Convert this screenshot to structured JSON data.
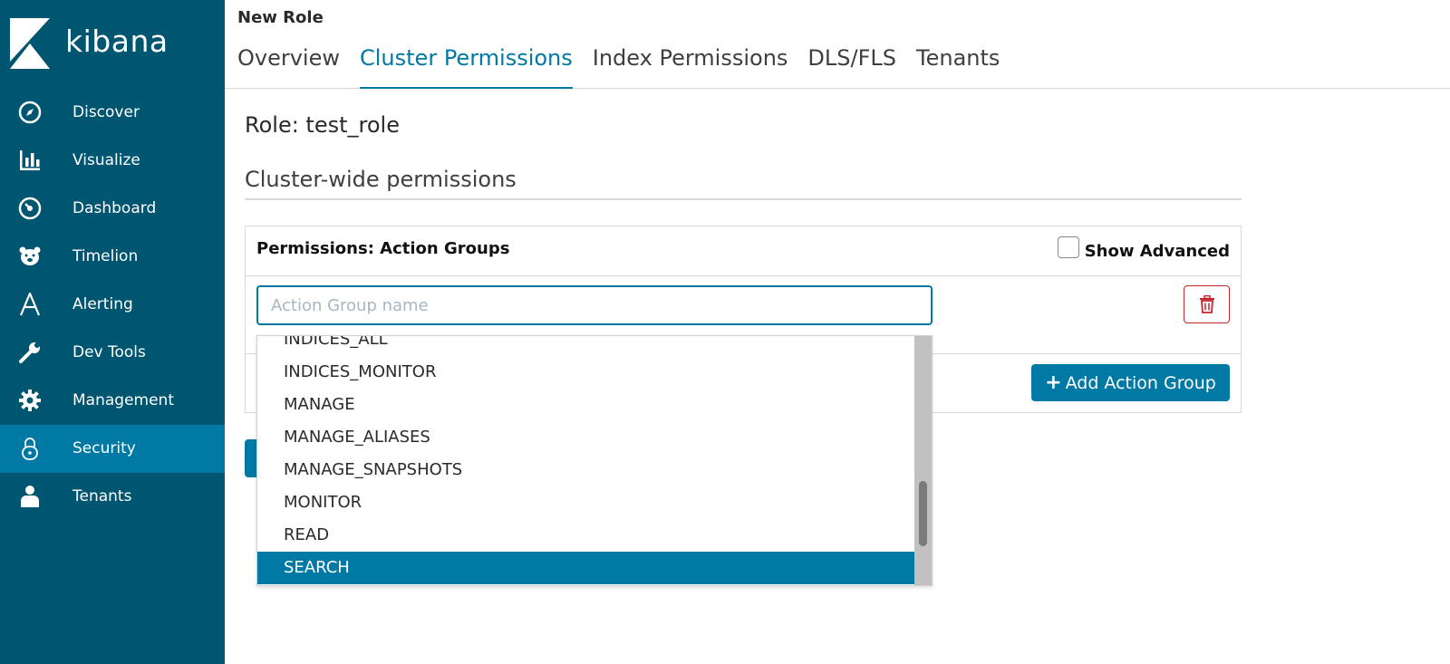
{
  "app": {
    "logo_text": "kibana"
  },
  "sidebar": {
    "items": [
      {
        "label": "Discover",
        "icon": "compass-icon",
        "active": false
      },
      {
        "label": "Visualize",
        "icon": "bar-chart-icon",
        "active": false
      },
      {
        "label": "Dashboard",
        "icon": "dashboard-gauge-icon",
        "active": false
      },
      {
        "label": "Timelion",
        "icon": "timelion-bear-icon",
        "active": false
      },
      {
        "label": "Alerting",
        "icon": "alerting-icon",
        "active": false
      },
      {
        "label": "Dev Tools",
        "icon": "wrench-icon",
        "active": false
      },
      {
        "label": "Management",
        "icon": "gear-icon",
        "active": false
      },
      {
        "label": "Security",
        "icon": "lock-icon",
        "active": true
      },
      {
        "label": "Tenants",
        "icon": "user-icon",
        "active": false
      }
    ]
  },
  "header": {
    "title": "New Role",
    "tabs": [
      {
        "label": "Overview",
        "active": false
      },
      {
        "label": "Cluster Permissions",
        "active": true
      },
      {
        "label": "Index Permissions",
        "active": false
      },
      {
        "label": "DLS/FLS",
        "active": false
      },
      {
        "label": "Tenants",
        "active": false
      }
    ]
  },
  "main": {
    "role_heading": "Role: test_role",
    "section_heading": "Cluster-wide permissions",
    "panel": {
      "title": "Permissions: Action Groups",
      "show_advanced_label": "Show Advanced",
      "show_advanced_checked": false,
      "input_placeholder": "Action Group name",
      "input_value": "",
      "add_button_label": "Add Action Group"
    }
  },
  "dropdown": {
    "options": [
      "INDICES_ALL",
      "INDICES_MONITOR",
      "MANAGE",
      "MANAGE_ALIASES",
      "MANAGE_SNAPSHOTS",
      "MONITOR",
      "READ",
      "SEARCH"
    ],
    "selected": "SEARCH"
  },
  "colors": {
    "sidebar_bg": "#005571",
    "accent": "#0079a5",
    "danger": "#c4262e"
  }
}
